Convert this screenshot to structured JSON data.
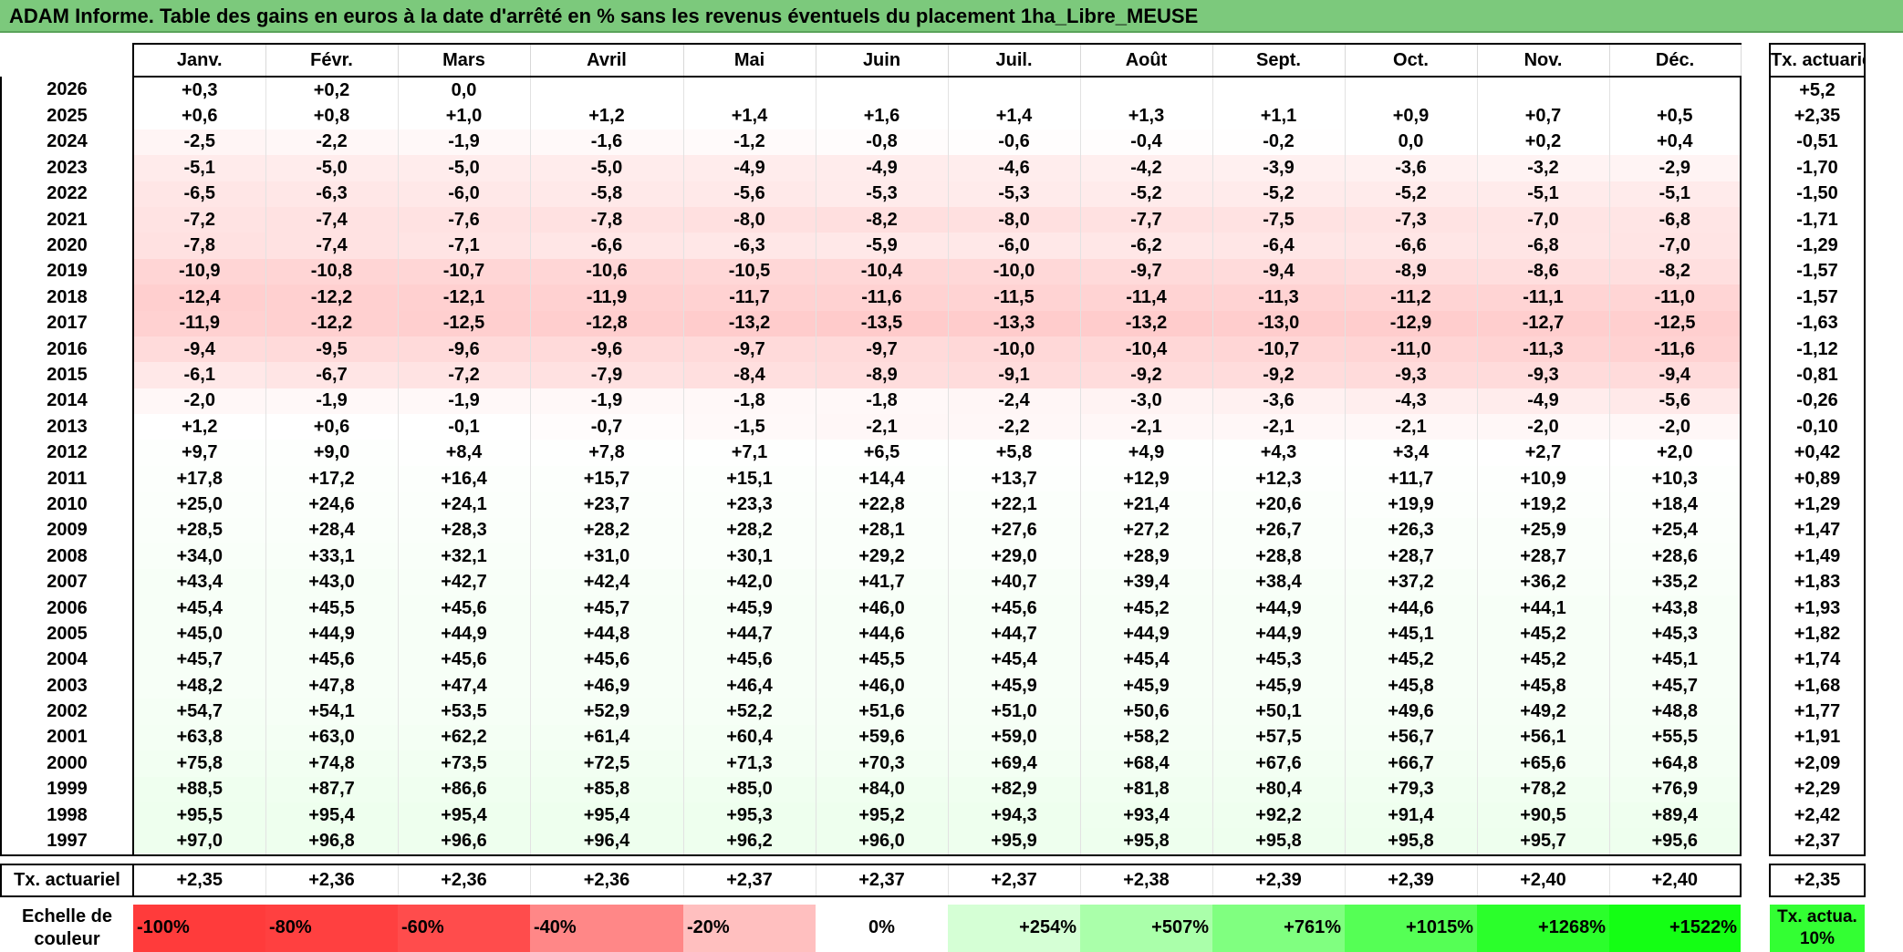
{
  "title": "ADAM Informe. Table des gains en euros à la date d'arrêté en % sans les revenus éventuels du placement 1ha_Libre_MEUSE",
  "months": [
    "Janv.",
    "Févr.",
    "Mars",
    "Avril",
    "Mai",
    "Juin",
    "Juil.",
    "Août",
    "Sept.",
    "Oct.",
    "Nov.",
    "Déc."
  ],
  "side_header": "Tx. actuariel",
  "rows": [
    {
      "year": "2026",
      "values": [
        "+0,3",
        "+0,2",
        "0,0",
        "",
        "",
        "",
        "",
        "",
        "",
        "",
        "",
        ""
      ],
      "rate": "+5,2"
    },
    {
      "year": "2025",
      "values": [
        "+0,6",
        "+0,8",
        "+1,0",
        "+1,2",
        "+1,4",
        "+1,6",
        "+1,4",
        "+1,3",
        "+1,1",
        "+0,9",
        "+0,7",
        "+0,5"
      ],
      "rate": "+2,35"
    },
    {
      "year": "2024",
      "values": [
        "-2,5",
        "-2,2",
        "-1,9",
        "-1,6",
        "-1,2",
        "-0,8",
        "-0,6",
        "-0,4",
        "-0,2",
        "0,0",
        "+0,2",
        "+0,4"
      ],
      "rate": "-0,51"
    },
    {
      "year": "2023",
      "values": [
        "-5,1",
        "-5,0",
        "-5,0",
        "-5,0",
        "-4,9",
        "-4,9",
        "-4,6",
        "-4,2",
        "-3,9",
        "-3,6",
        "-3,2",
        "-2,9"
      ],
      "rate": "-1,70"
    },
    {
      "year": "2022",
      "values": [
        "-6,5",
        "-6,3",
        "-6,0",
        "-5,8",
        "-5,6",
        "-5,3",
        "-5,3",
        "-5,2",
        "-5,2",
        "-5,2",
        "-5,1",
        "-5,1"
      ],
      "rate": "-1,50"
    },
    {
      "year": "2021",
      "values": [
        "-7,2",
        "-7,4",
        "-7,6",
        "-7,8",
        "-8,0",
        "-8,2",
        "-8,0",
        "-7,7",
        "-7,5",
        "-7,3",
        "-7,0",
        "-6,8"
      ],
      "rate": "-1,71"
    },
    {
      "year": "2020",
      "values": [
        "-7,8",
        "-7,4",
        "-7,1",
        "-6,6",
        "-6,3",
        "-5,9",
        "-6,0",
        "-6,2",
        "-6,4",
        "-6,6",
        "-6,8",
        "-7,0"
      ],
      "rate": "-1,29"
    },
    {
      "year": "2019",
      "values": [
        "-10,9",
        "-10,8",
        "-10,7",
        "-10,6",
        "-10,5",
        "-10,4",
        "-10,0",
        "-9,7",
        "-9,4",
        "-8,9",
        "-8,6",
        "-8,2"
      ],
      "rate": "-1,57"
    },
    {
      "year": "2018",
      "values": [
        "-12,4",
        "-12,2",
        "-12,1",
        "-11,9",
        "-11,7",
        "-11,6",
        "-11,5",
        "-11,4",
        "-11,3",
        "-11,2",
        "-11,1",
        "-11,0"
      ],
      "rate": "-1,57"
    },
    {
      "year": "2017",
      "values": [
        "-11,9",
        "-12,2",
        "-12,5",
        "-12,8",
        "-13,2",
        "-13,5",
        "-13,3",
        "-13,2",
        "-13,0",
        "-12,9",
        "-12,7",
        "-12,5"
      ],
      "rate": "-1,63"
    },
    {
      "year": "2016",
      "values": [
        "-9,4",
        "-9,5",
        "-9,6",
        "-9,6",
        "-9,7",
        "-9,7",
        "-10,0",
        "-10,4",
        "-10,7",
        "-11,0",
        "-11,3",
        "-11,6"
      ],
      "rate": "-1,12"
    },
    {
      "year": "2015",
      "values": [
        "-6,1",
        "-6,7",
        "-7,2",
        "-7,9",
        "-8,4",
        "-8,9",
        "-9,1",
        "-9,2",
        "-9,2",
        "-9,3",
        "-9,3",
        "-9,4"
      ],
      "rate": "-0,81"
    },
    {
      "year": "2014",
      "values": [
        "-2,0",
        "-1,9",
        "-1,9",
        "-1,9",
        "-1,8",
        "-1,8",
        "-2,4",
        "-3,0",
        "-3,6",
        "-4,3",
        "-4,9",
        "-5,6"
      ],
      "rate": "-0,26"
    },
    {
      "year": "2013",
      "values": [
        "+1,2",
        "+0,6",
        "-0,1",
        "-0,7",
        "-1,5",
        "-2,1",
        "-2,2",
        "-2,1",
        "-2,1",
        "-2,1",
        "-2,0",
        "-2,0"
      ],
      "rate": "-0,10"
    },
    {
      "year": "2012",
      "values": [
        "+9,7",
        "+9,0",
        "+8,4",
        "+7,8",
        "+7,1",
        "+6,5",
        "+5,8",
        "+4,9",
        "+4,3",
        "+3,4",
        "+2,7",
        "+2,0"
      ],
      "rate": "+0,42"
    },
    {
      "year": "2011",
      "values": [
        "+17,8",
        "+17,2",
        "+16,4",
        "+15,7",
        "+15,1",
        "+14,4",
        "+13,7",
        "+12,9",
        "+12,3",
        "+11,7",
        "+10,9",
        "+10,3"
      ],
      "rate": "+0,89"
    },
    {
      "year": "2010",
      "values": [
        "+25,0",
        "+24,6",
        "+24,1",
        "+23,7",
        "+23,3",
        "+22,8",
        "+22,1",
        "+21,4",
        "+20,6",
        "+19,9",
        "+19,2",
        "+18,4"
      ],
      "rate": "+1,29"
    },
    {
      "year": "2009",
      "values": [
        "+28,5",
        "+28,4",
        "+28,3",
        "+28,2",
        "+28,2",
        "+28,1",
        "+27,6",
        "+27,2",
        "+26,7",
        "+26,3",
        "+25,9",
        "+25,4"
      ],
      "rate": "+1,47"
    },
    {
      "year": "2008",
      "values": [
        "+34,0",
        "+33,1",
        "+32,1",
        "+31,0",
        "+30,1",
        "+29,2",
        "+29,0",
        "+28,9",
        "+28,8",
        "+28,7",
        "+28,7",
        "+28,6"
      ],
      "rate": "+1,49"
    },
    {
      "year": "2007",
      "values": [
        "+43,4",
        "+43,0",
        "+42,7",
        "+42,4",
        "+42,0",
        "+41,7",
        "+40,7",
        "+39,4",
        "+38,4",
        "+37,2",
        "+36,2",
        "+35,2"
      ],
      "rate": "+1,83"
    },
    {
      "year": "2006",
      "values": [
        "+45,4",
        "+45,5",
        "+45,6",
        "+45,7",
        "+45,9",
        "+46,0",
        "+45,6",
        "+45,2",
        "+44,9",
        "+44,6",
        "+44,1",
        "+43,8"
      ],
      "rate": "+1,93"
    },
    {
      "year": "2005",
      "values": [
        "+45,0",
        "+44,9",
        "+44,9",
        "+44,8",
        "+44,7",
        "+44,6",
        "+44,7",
        "+44,9",
        "+44,9",
        "+45,1",
        "+45,2",
        "+45,3"
      ],
      "rate": "+1,82"
    },
    {
      "year": "2004",
      "values": [
        "+45,7",
        "+45,6",
        "+45,6",
        "+45,6",
        "+45,6",
        "+45,5",
        "+45,4",
        "+45,4",
        "+45,3",
        "+45,2",
        "+45,2",
        "+45,1"
      ],
      "rate": "+1,74"
    },
    {
      "year": "2003",
      "values": [
        "+48,2",
        "+47,8",
        "+47,4",
        "+46,9",
        "+46,4",
        "+46,0",
        "+45,9",
        "+45,9",
        "+45,9",
        "+45,8",
        "+45,8",
        "+45,7"
      ],
      "rate": "+1,68"
    },
    {
      "year": "2002",
      "values": [
        "+54,7",
        "+54,1",
        "+53,5",
        "+52,9",
        "+52,2",
        "+51,6",
        "+51,0",
        "+50,6",
        "+50,1",
        "+49,6",
        "+49,2",
        "+48,8"
      ],
      "rate": "+1,77"
    },
    {
      "year": "2001",
      "values": [
        "+63,8",
        "+63,0",
        "+62,2",
        "+61,4",
        "+60,4",
        "+59,6",
        "+59,0",
        "+58,2",
        "+57,5",
        "+56,7",
        "+56,1",
        "+55,5"
      ],
      "rate": "+1,91"
    },
    {
      "year": "2000",
      "values": [
        "+75,8",
        "+74,8",
        "+73,5",
        "+72,5",
        "+71,3",
        "+70,3",
        "+69,4",
        "+68,4",
        "+67,6",
        "+66,7",
        "+65,6",
        "+64,8"
      ],
      "rate": "+2,09"
    },
    {
      "year": "1999",
      "values": [
        "+88,5",
        "+87,7",
        "+86,6",
        "+85,8",
        "+85,0",
        "+84,0",
        "+82,9",
        "+81,8",
        "+80,4",
        "+79,3",
        "+78,2",
        "+76,9"
      ],
      "rate": "+2,29"
    },
    {
      "year": "1998",
      "values": [
        "+95,5",
        "+95,4",
        "+95,4",
        "+95,4",
        "+95,3",
        "+95,2",
        "+94,3",
        "+93,4",
        "+92,2",
        "+91,4",
        "+90,5",
        "+89,4"
      ],
      "rate": "+2,42"
    },
    {
      "year": "1997",
      "values": [
        "+97,0",
        "+96,8",
        "+96,6",
        "+96,4",
        "+96,2",
        "+96,0",
        "+95,9",
        "+95,8",
        "+95,8",
        "+95,8",
        "+95,7",
        "+95,6"
      ],
      "rate": "+2,37"
    }
  ],
  "tax_row": {
    "label": "Tx. actuariel",
    "values": [
      "+2,35",
      "+2,36",
      "+2,36",
      "+2,36",
      "+2,37",
      "+2,37",
      "+2,37",
      "+2,38",
      "+2,39",
      "+2,39",
      "+2,40",
      "+2,40"
    ],
    "rate": "+2,35"
  },
  "scale": {
    "label": "Echelle de couleur",
    "items": [
      {
        "label": "-100%",
        "color": "#ff3b3b",
        "align": "left"
      },
      {
        "label": "-80%",
        "color": "#ff4040",
        "align": "left"
      },
      {
        "label": "-60%",
        "color": "#ff4c4c",
        "align": "left"
      },
      {
        "label": "-40%",
        "color": "#ff8787",
        "align": "left"
      },
      {
        "label": "-20%",
        "color": "#ffbfbf",
        "align": "left"
      },
      {
        "label": "0%",
        "color": "#ffffff",
        "align": "center"
      },
      {
        "label": "+254%",
        "color": "#d5ffd5",
        "align": "right"
      },
      {
        "label": "+507%",
        "color": "#aaffaa",
        "align": "right"
      },
      {
        "label": "+761%",
        "color": "#80ff80",
        "align": "right"
      },
      {
        "label": "+1015%",
        "color": "#55ff55",
        "align": "right"
      },
      {
        "label": "+1268%",
        "color": "#2bff2b",
        "align": "right"
      },
      {
        "label": "+1522%",
        "color": "#14ff14",
        "align": "right"
      }
    ],
    "side_label": "Tx. actua. 10%",
    "side_color": "#33ff33"
  },
  "colors": {
    "title_bar": "#7cc97c",
    "negative_tint": "#ff0000",
    "positive_tint": "#00ff00"
  }
}
